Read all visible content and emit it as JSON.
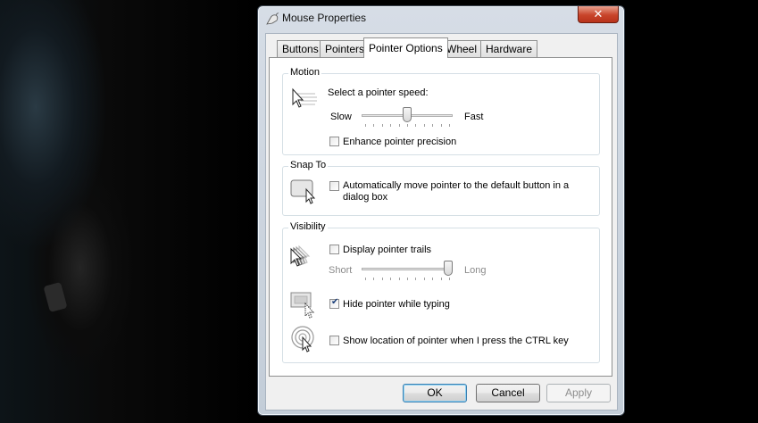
{
  "window": {
    "title": "Mouse Properties",
    "close_glyph": "✕"
  },
  "tabs": [
    {
      "label": "Buttons",
      "active": false
    },
    {
      "label": "Pointers",
      "active": false
    },
    {
      "label": "Pointer Options",
      "active": true
    },
    {
      "label": "Wheel",
      "active": false
    },
    {
      "label": "Hardware",
      "active": false
    }
  ],
  "motion": {
    "group_label": "Motion",
    "speed_label": "Select a pointer speed:",
    "slow_label": "Slow",
    "fast_label": "Fast",
    "speed_level_fraction": 0.5,
    "precision_label": "Enhance pointer precision",
    "precision_checked": false
  },
  "snap_to": {
    "group_label": "Snap To",
    "auto_move_label_line1": "Automatically move pointer to the default button in a",
    "auto_move_label_line2": "dialog box",
    "auto_move_checked": false
  },
  "visibility": {
    "group_label": "Visibility",
    "trails_label": "Display pointer trails",
    "trails_checked": false,
    "short_label": "Short",
    "long_label": "Long",
    "trail_length_fraction": 1.0,
    "hide_typing_label": "Hide pointer while typing",
    "hide_typing_checked": true,
    "ctrl_location_label": "Show location of pointer when I press the CTRL key",
    "ctrl_location_checked": false
  },
  "buttons": {
    "ok": "OK",
    "cancel": "Cancel",
    "apply": "Apply"
  },
  "icons": {
    "title": "mouse-icon",
    "motion": "pointer-speed-icon",
    "snap": "snap-to-icon",
    "trails": "pointer-trails-icon",
    "hide": "hide-pointer-icon",
    "ctrl": "pointer-location-icon"
  }
}
